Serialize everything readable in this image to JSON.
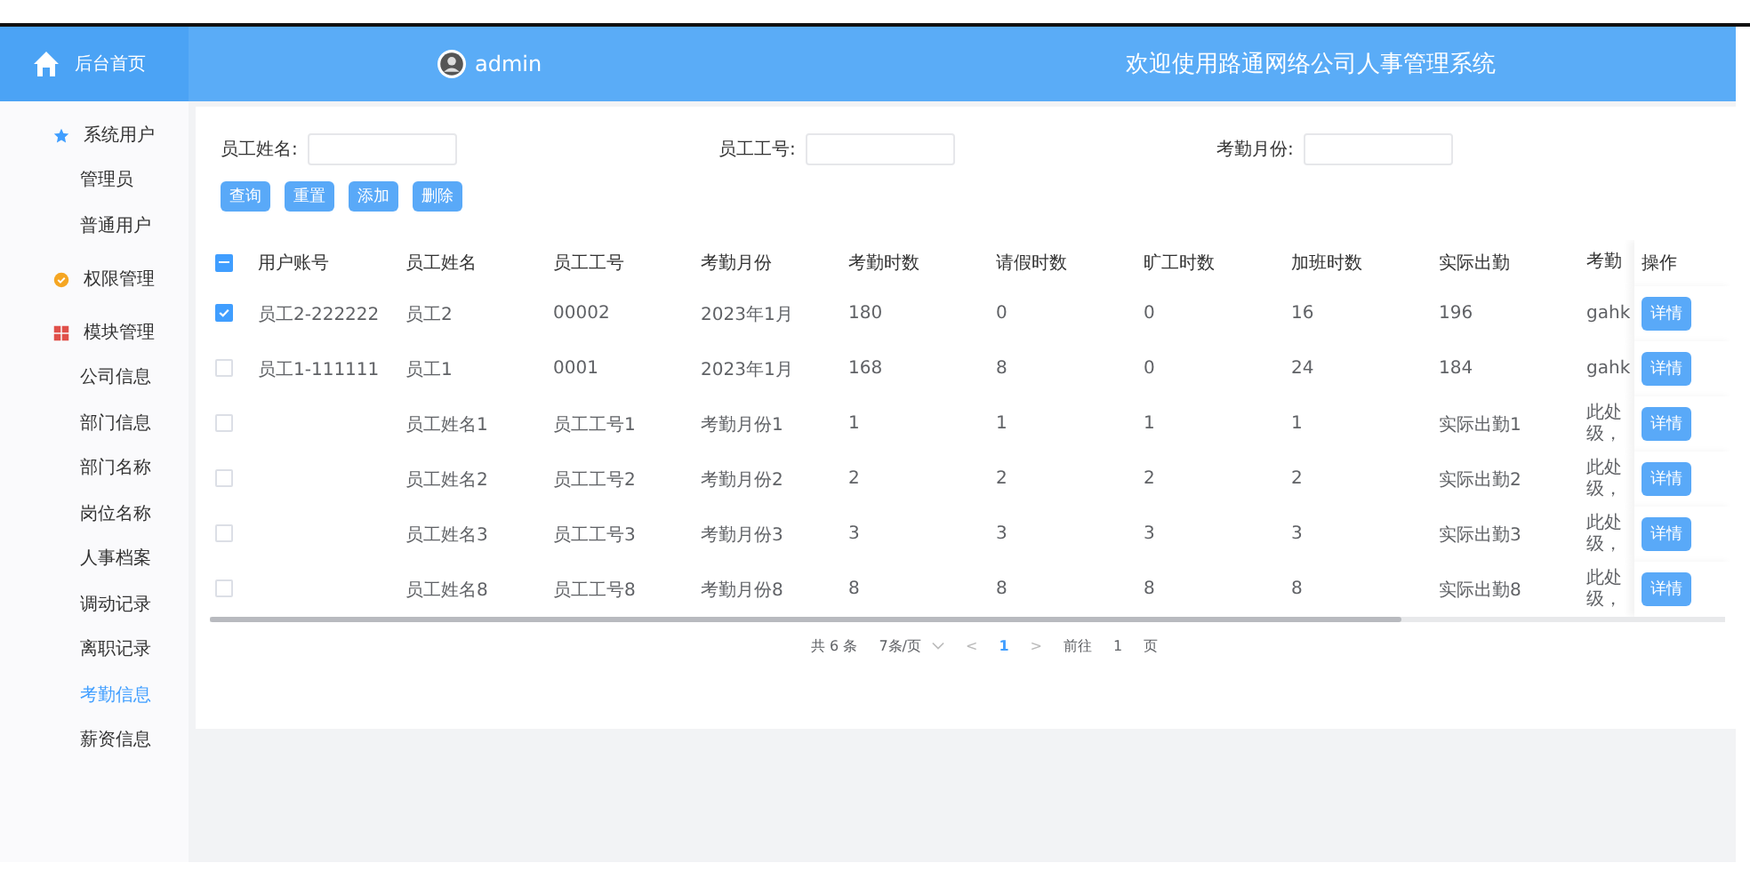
{
  "brand": {
    "label": "后台首页"
  },
  "header": {
    "user": "admin",
    "title": "欢迎使用路通网络公司人事管理系统"
  },
  "sidebar": {
    "items": [
      {
        "label": "系统用户",
        "children": [
          {
            "label": "管理员",
            "selected": false
          },
          {
            "label": "普通用户",
            "selected": false
          }
        ]
      },
      {
        "label": "权限管理"
      },
      {
        "label": "模块管理",
        "children": [
          {
            "label": "公司信息",
            "selected": false
          },
          {
            "label": "部门信息",
            "selected": false
          },
          {
            "label": "部门名称",
            "selected": false
          },
          {
            "label": "岗位名称",
            "selected": false
          },
          {
            "label": "人事档案",
            "selected": false
          },
          {
            "label": "调动记录",
            "selected": false
          },
          {
            "label": "离职记录",
            "selected": false
          },
          {
            "label": "考勤信息",
            "selected": true
          },
          {
            "label": "薪资信息",
            "selected": false
          }
        ]
      }
    ]
  },
  "search": {
    "fields": [
      {
        "label": "员工姓名:"
      },
      {
        "label": "员工工号:"
      },
      {
        "label": "考勤月份:"
      }
    ],
    "buttons": [
      "查询",
      "重置",
      "添加",
      "删除"
    ]
  },
  "table": {
    "select_all_mixed": true,
    "columns": [
      "用户账号",
      "员工姓名",
      "员工工号",
      "考勤月份",
      "考勤时数",
      "请假时数",
      "旷工时数",
      "加班时数",
      "实际出勤",
      "考勤"
    ],
    "action_column": "操作",
    "rows": [
      {
        "checked": true,
        "cells": [
          "员工2-222222",
          "员工2",
          "00002",
          "2023年1月",
          "180",
          "0",
          "0",
          "16",
          "196",
          "gahk"
        ],
        "action": "详情"
      },
      {
        "checked": false,
        "cells": [
          "员工1-111111",
          "员工1",
          "0001",
          "2023年1月",
          "168",
          "8",
          "0",
          "24",
          "184",
          "gahk"
        ],
        "action": "详情"
      },
      {
        "checked": false,
        "cells": [
          "",
          "员工姓名1",
          "员工工号1",
          "考勤月份1",
          "1",
          "1",
          "1",
          "1",
          "实际出勤1",
          "此处级，"
        ],
        "action": "详情"
      },
      {
        "checked": false,
        "cells": [
          "",
          "员工姓名2",
          "员工工号2",
          "考勤月份2",
          "2",
          "2",
          "2",
          "2",
          "实际出勤2",
          "此处级，"
        ],
        "action": "详情"
      },
      {
        "checked": false,
        "cells": [
          "",
          "员工姓名3",
          "员工工号3",
          "考勤月份3",
          "3",
          "3",
          "3",
          "3",
          "实际出勤3",
          "此处级，"
        ],
        "action": "详情"
      },
      {
        "checked": false,
        "cells": [
          "",
          "员工姓名8",
          "员工工号8",
          "考勤月份8",
          "8",
          "8",
          "8",
          "8",
          "实际出勤8",
          "此处级，"
        ],
        "action": "详情"
      }
    ]
  },
  "pagination": {
    "total": "共 6 条",
    "page_size": "7条/页",
    "prev": "<",
    "pages": [
      {
        "label": "1",
        "selected": true
      }
    ],
    "next": ">",
    "goto_label": "前往",
    "goto_value": "1",
    "goto_suffix": "页"
  }
}
